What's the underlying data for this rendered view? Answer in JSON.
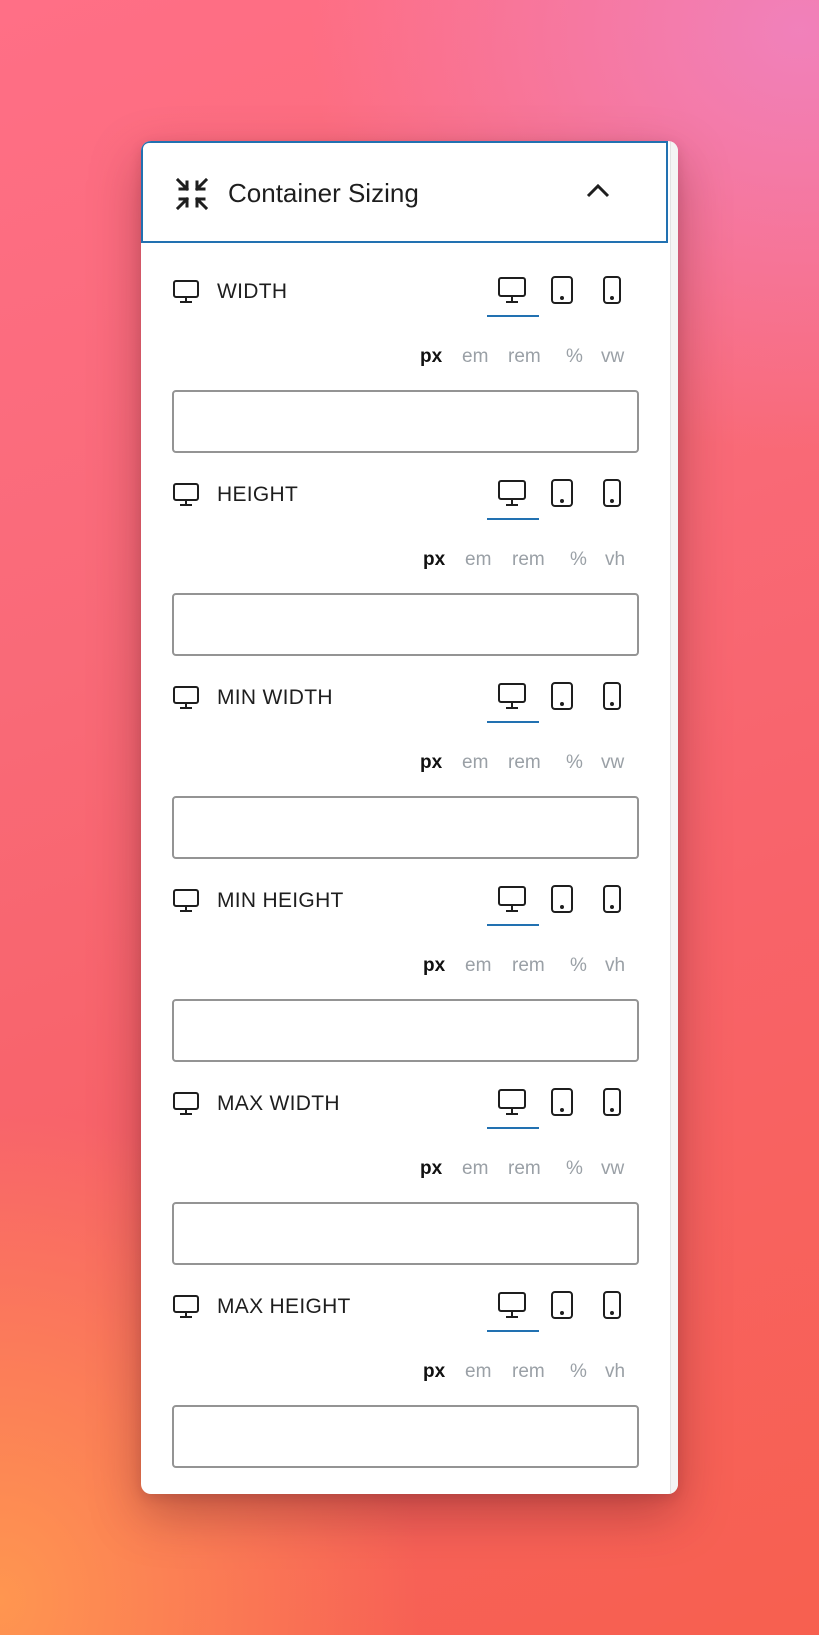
{
  "panel": {
    "title": "Container Sizing",
    "header_icon": "shrink-arrows-icon",
    "collapse_icon": "chevron-up-icon"
  },
  "controls": [
    {
      "label": "WIDTH",
      "units": [
        "px",
        "em",
        "rem",
        "%",
        "vw"
      ],
      "active_unit": "px",
      "active_device": "desktop",
      "value": ""
    },
    {
      "label": "HEIGHT",
      "units": [
        "px",
        "em",
        "rem",
        "%",
        "vh"
      ],
      "active_unit": "px",
      "active_device": "desktop",
      "value": ""
    },
    {
      "label": "MIN WIDTH",
      "units": [
        "px",
        "em",
        "rem",
        "%",
        "vw"
      ],
      "active_unit": "px",
      "active_device": "desktop",
      "value": ""
    },
    {
      "label": "MIN HEIGHT",
      "units": [
        "px",
        "em",
        "rem",
        "%",
        "vh"
      ],
      "active_unit": "px",
      "active_device": "desktop",
      "value": ""
    },
    {
      "label": "MAX WIDTH",
      "units": [
        "px",
        "em",
        "rem",
        "%",
        "vw"
      ],
      "active_unit": "px",
      "active_device": "desktop",
      "value": ""
    },
    {
      "label": "MAX HEIGHT",
      "units": [
        "px",
        "em",
        "rem",
        "%",
        "vh"
      ],
      "active_unit": "px",
      "active_device": "desktop",
      "value": ""
    }
  ],
  "icons": {
    "label": "desktop-icon",
    "devices": [
      "desktop-icon",
      "tablet-icon",
      "mobile-icon"
    ]
  },
  "colors": {
    "accent": "#2271b1",
    "text": "#1e1e1e",
    "muted_unit": "#9aa0a6",
    "field_border": "#949494"
  }
}
